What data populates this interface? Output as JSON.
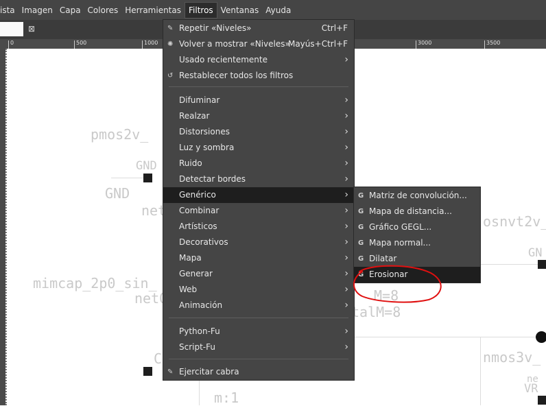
{
  "menubar": {
    "items": [
      "ista",
      "Imagen",
      "Capa",
      "Colores",
      "Herramientas",
      "Filtros",
      "Ventanas",
      "Ayuda"
    ],
    "active": "Filtros"
  },
  "tab": {
    "close_glyph": "⊠"
  },
  "ruler": {
    "labels": [
      "0",
      "500",
      "1000",
      "3000",
      "3500"
    ]
  },
  "canvas": {
    "texts": [
      "pmos2v_",
      "GND",
      "GND",
      "net",
      "mimcap_2p0_sin_",
      "net0",
      "M=8",
      "talM=8",
      "osnvt2v_",
      "GN",
      "nmos3v_",
      "C",
      "m:1",
      "ne",
      "VR"
    ]
  },
  "filters_menu": {
    "items": [
      {
        "label": "Repetir «Niveles»",
        "accel": "Ctrl+F",
        "icon": "repeat-icon"
      },
      {
        "label": "Volver a mostrar «Niveles»",
        "accel": "Mayús+Ctrl+F",
        "icon": "reshow-icon"
      },
      {
        "label": "Usado recientemente",
        "submenu": true
      },
      {
        "label": "Restablecer todos los filtros",
        "icon": "reset-icon"
      },
      {
        "label": "Difuminar",
        "submenu": true
      },
      {
        "label": "Realzar",
        "submenu": true
      },
      {
        "label": "Distorsiones",
        "submenu": true
      },
      {
        "label": "Luz y sombra",
        "submenu": true
      },
      {
        "label": "Ruido",
        "submenu": true
      },
      {
        "label": "Detectar bordes",
        "submenu": true
      },
      {
        "label": "Genérico",
        "submenu": true,
        "highlighted": true
      },
      {
        "label": "Combinar",
        "submenu": true
      },
      {
        "label": "Artísticos",
        "submenu": true
      },
      {
        "label": "Decorativos",
        "submenu": true
      },
      {
        "label": "Mapa",
        "submenu": true
      },
      {
        "label": "Generar",
        "submenu": true
      },
      {
        "label": "Web",
        "submenu": true
      },
      {
        "label": "Animación",
        "submenu": true
      },
      {
        "label": "Python-Fu",
        "submenu": true
      },
      {
        "label": "Script-Fu",
        "submenu": true
      },
      {
        "label": "Ejercitar cabra",
        "icon": "goat-icon"
      }
    ]
  },
  "generic_submenu": {
    "icon_glyph": "G",
    "items": [
      {
        "label": "Matriz de convolución..."
      },
      {
        "label": "Mapa de distancia..."
      },
      {
        "label": "Gráfico GEGL..."
      },
      {
        "label": "Mapa normal..."
      },
      {
        "label": "Dilatar"
      },
      {
        "label": "Erosionar",
        "highlighted": true
      }
    ]
  },
  "colors": {
    "menu_bg": "#454545",
    "highlight_bg": "#1e1e1e",
    "annotation": "#e01010"
  },
  "glyphs": {
    "submenu_arrow": "›"
  }
}
